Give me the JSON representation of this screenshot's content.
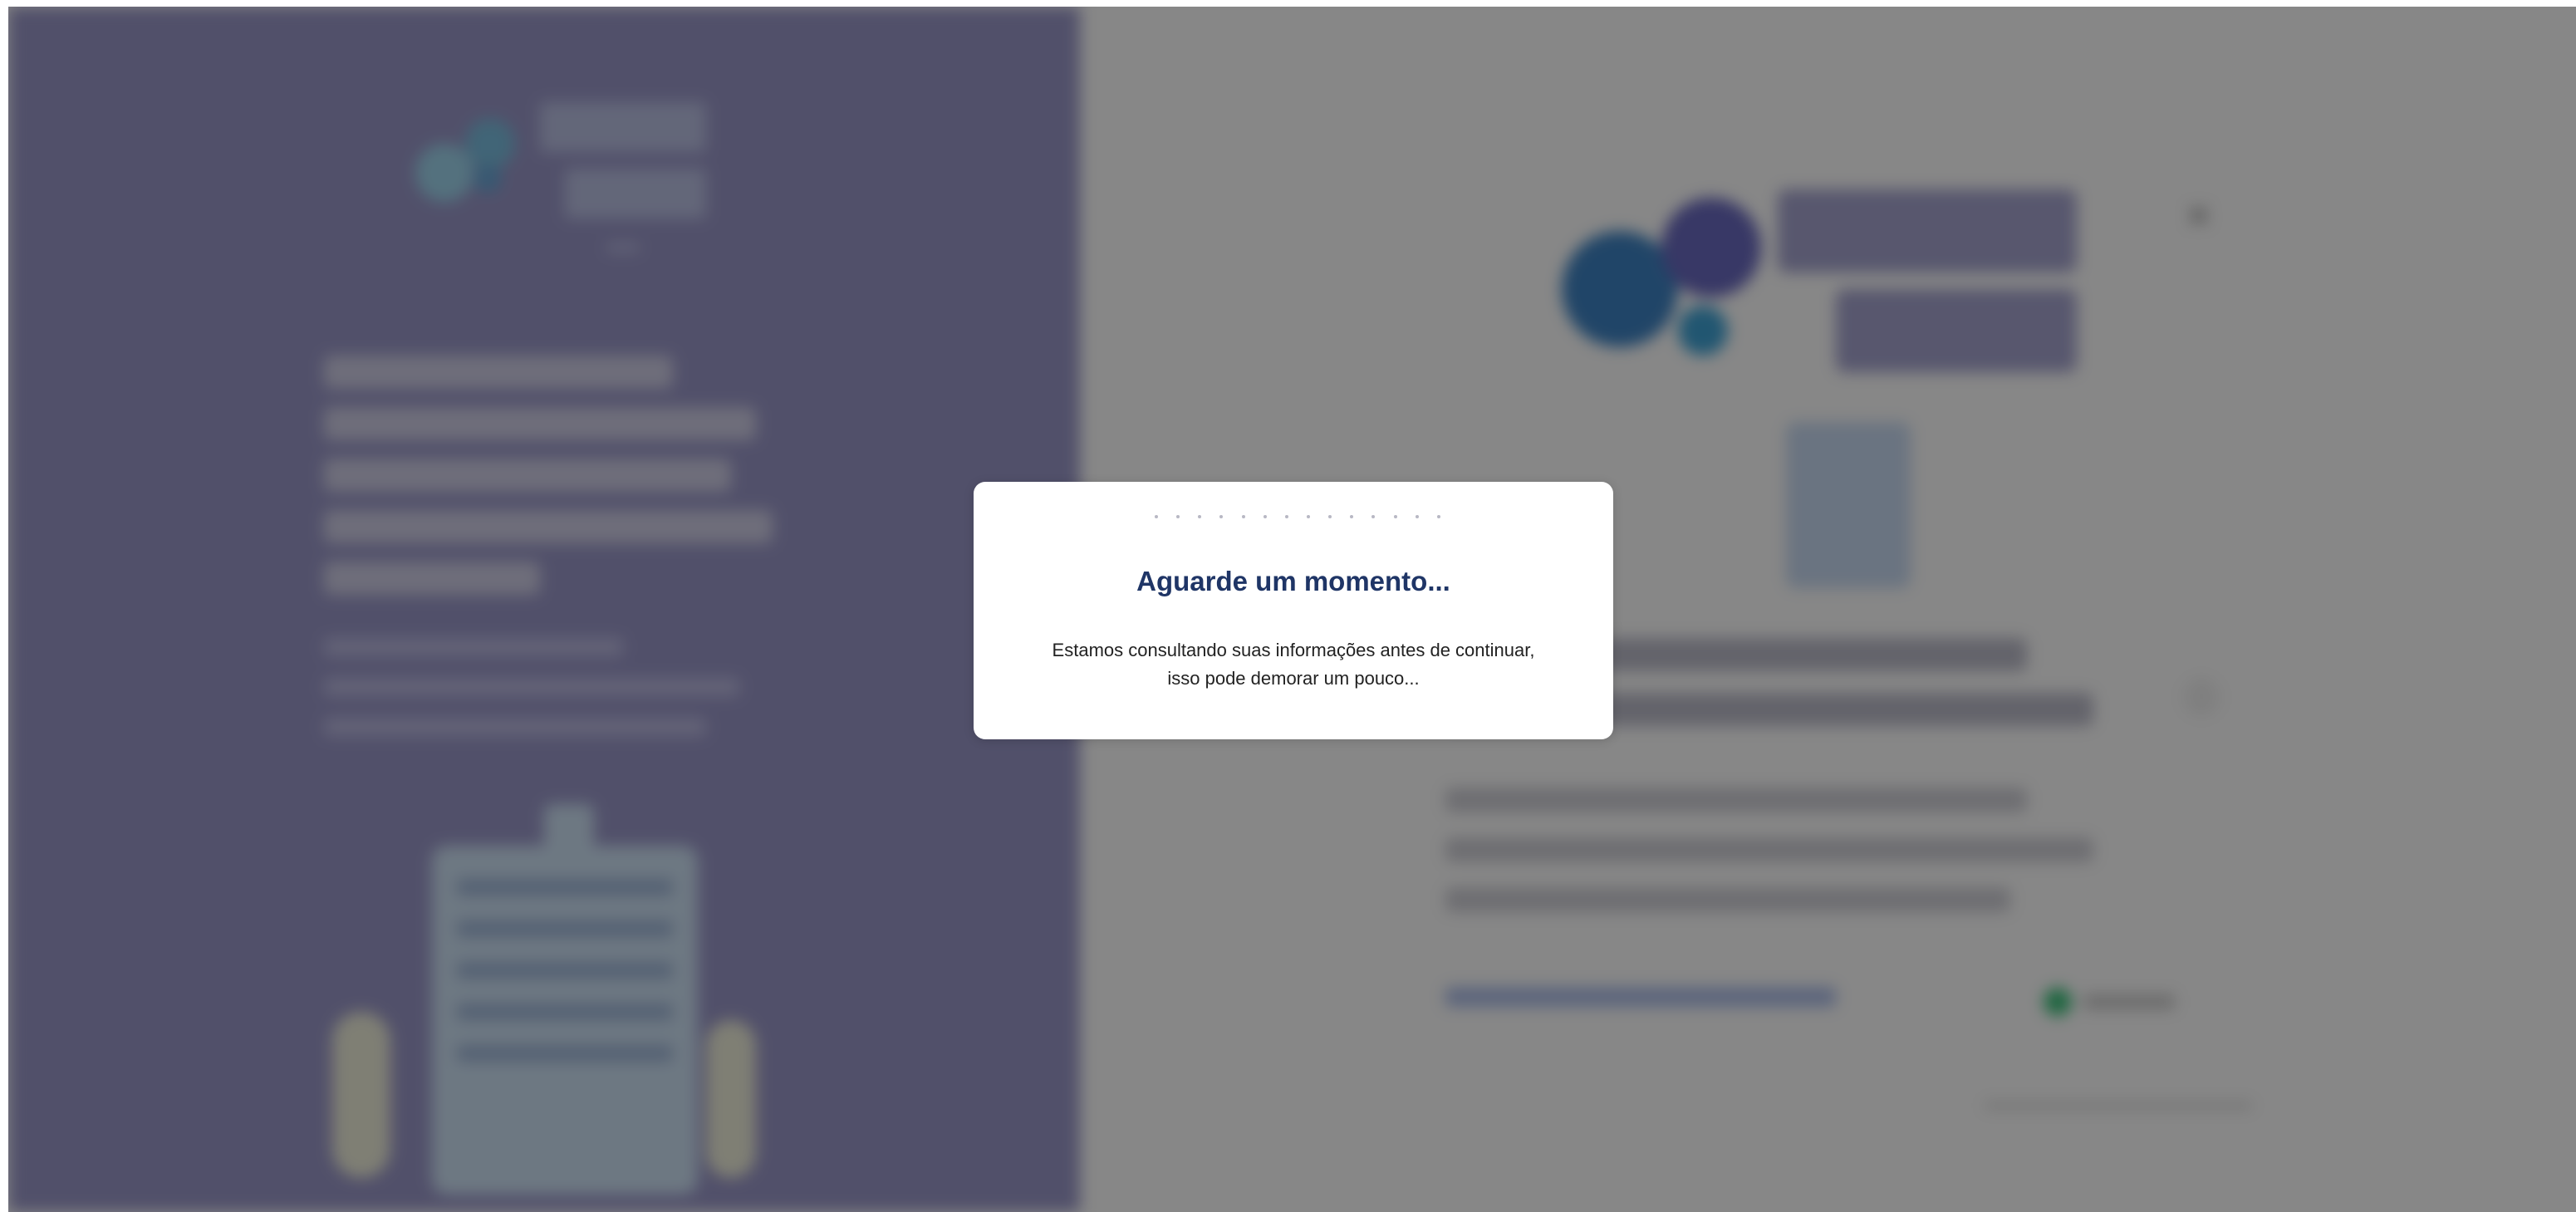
{
  "modal": {
    "title": "Aguarde um momento...",
    "message_line1": "Estamos consultando suas informações antes de continuar,",
    "message_line2": "isso pode demorar um pouco..."
  },
  "colors": {
    "overlay": "#000000",
    "left_panel": "#9a98c9",
    "right_panel": "#ffffff",
    "modal_title": "#1f3566",
    "modal_bg": "#ffffff",
    "radio_accent": "#3bc17a"
  },
  "icons": {
    "loader": "loading-dots-icon",
    "close": "close-icon",
    "info": "info-icon"
  }
}
